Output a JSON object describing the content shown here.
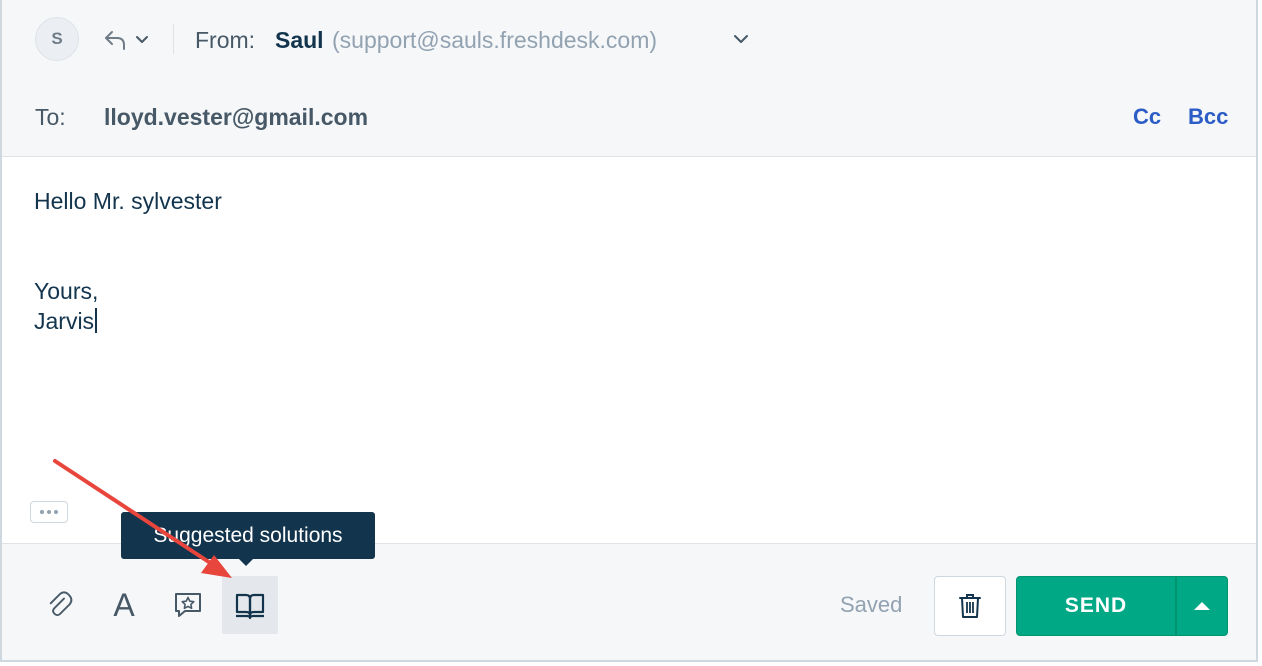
{
  "from": {
    "avatar_initial": "S",
    "label": "From:",
    "name": "Saul",
    "email": "(support@sauls.freshdesk.com)"
  },
  "to": {
    "label": "To:",
    "email": "lloyd.vester@gmail.com",
    "cc_label": "Cc",
    "bcc_label": "Bcc"
  },
  "body": {
    "lines": [
      "Hello Mr. sylvester",
      "Yours,",
      "Jarvis"
    ]
  },
  "toolbar": {
    "tools": [
      "paperclip-icon",
      "font-icon",
      "canned-response-icon",
      "book-icon"
    ],
    "font_glyph": "A",
    "tooltip": "Suggested solutions",
    "saved_text": "Saved",
    "send_label": "SEND"
  },
  "colors": {
    "send_green": "#00a886",
    "link_blue": "#2c5cc5",
    "annotation_red": "#e8453c",
    "tooltip_bg": "#12344d"
  }
}
